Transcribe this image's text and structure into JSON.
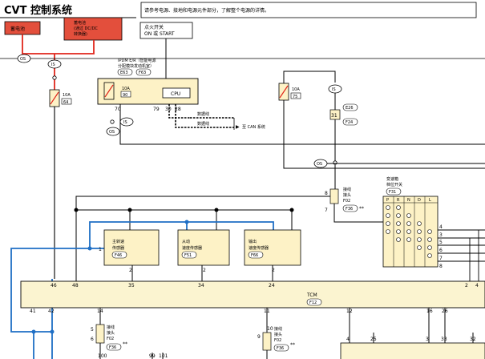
{
  "header": {
    "title": "CVT 控制系统",
    "note": "请参考电源、接地和电源元件部分，了解整个电源的详情。"
  },
  "power": {
    "battery": "蓄电池",
    "battery_dcdc_line1": "蓄电池",
    "battery_dcdc_line2": "(通过 DC/DC",
    "battery_dcdc_line3": "转换器)",
    "ignition_line1": "点火开关",
    "ignition_line2": "ON 或 START"
  },
  "labels": {
    "os": "OS",
    "is": "IS",
    "fuse_10a": "10A",
    "cpu": "CPU",
    "data_line": "数据线",
    "to_can": "至 CAN 系统",
    "connector": "接线",
    "connector2": "接头",
    "star": "**"
  },
  "ipdm": {
    "line1": "IPDM E/R（智能电源",
    "line2": "分配模块发动机室）",
    "conn1": "E63",
    "conn2": "F63"
  },
  "fuses": [
    {
      "amp": "10A",
      "num": "64"
    },
    {
      "amp": "10A",
      "num": "90"
    },
    {
      "amp": "10A",
      "num": "75"
    }
  ],
  "connectors": {
    "e26": "E26",
    "f24": "F24",
    "f02": "F02",
    "f36": "F36",
    "f31": "F31",
    "f12": "F12"
  },
  "range_switch": {
    "line1": "变速箱",
    "line2": "档位开关",
    "positions": [
      "P",
      "R",
      "N",
      "D",
      "L"
    ]
  },
  "sensors": [
    {
      "line1": "主转速",
      "line2": "传感器",
      "conn": "F46"
    },
    {
      "line1": "从动",
      "line2": "速度传感器",
      "conn": "F51"
    },
    {
      "line1": "输出",
      "line2": "速度传感器",
      "conn": "F66"
    }
  ],
  "tcm": {
    "name": "TCM",
    "conn": "F12"
  },
  "pins": {
    "p70": "70",
    "p79": "79",
    "p30": "30",
    "p28": "28",
    "p31": "31",
    "p8": "8",
    "p7": "7",
    "p1": "1",
    "p2": "2",
    "p46": "46",
    "p48": "48",
    "p35": "35",
    "p34": "34",
    "p24": "24",
    "p4": "4",
    "p41": "41",
    "p42": "42",
    "p14": "14",
    "p11": "11",
    "p12": "12",
    "p16": "16",
    "p26": "26",
    "p5": "5",
    "p6": "6",
    "p9": "9",
    "p10": "10",
    "p25": "25",
    "p99": "99",
    "p100": "100",
    "p101": "101",
    "p3": "3",
    "p32": "32",
    "p33": "33"
  },
  "colors": {
    "red": "#e0261b",
    "blue": "#1f6fc5",
    "fuse_fill": "#fdf2c6",
    "battery_fill": "#e34f3c",
    "tcm_fill": "#fbf4d0"
  }
}
